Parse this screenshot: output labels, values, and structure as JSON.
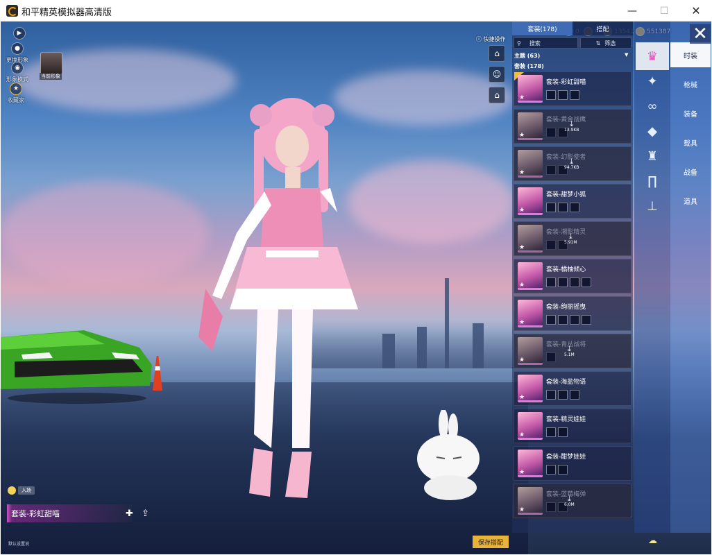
{
  "window": {
    "title": "和平精英模拟器高清版",
    "minimize": "—",
    "maximize": "☐",
    "close": "✕"
  },
  "hud_left": [
    {
      "label": "更换形象",
      "icon": "person-icon"
    },
    {
      "label": "形象模式",
      "icon": "eye-icon"
    },
    {
      "label": "收藏家",
      "icon": "badge-icon"
    }
  ],
  "avatar_caption": "当前形象",
  "quick": {
    "label": "快捷操作"
  },
  "currency": [
    "0",
    "0",
    "13541",
    "551387"
  ],
  "list": {
    "tabs": [
      "套装(178)",
      "搭配"
    ],
    "search_label": "搜索",
    "filter_label": "筛选",
    "group_theme": "主题 (63)",
    "group_suit": "套装 (178)",
    "items": [
      {
        "name": "套装-彩虹甜喵",
        "dim": false,
        "minis": 3,
        "size": ""
      },
      {
        "name": "套装-黄金战鹰",
        "dim": true,
        "minis": 2,
        "size": "13.9KB"
      },
      {
        "name": "套装-幻影使者",
        "dim": true,
        "minis": 2,
        "size": "94.7KB"
      },
      {
        "name": "套装-甜梦小狐",
        "dim": false,
        "minis": 3,
        "size": ""
      },
      {
        "name": "套装-潮影精灵",
        "dim": true,
        "minis": 2,
        "size": "5.91M"
      },
      {
        "name": "套装-橘柚倾心",
        "dim": false,
        "minis": 4,
        "size": ""
      },
      {
        "name": "套装-绚丽摇曳",
        "dim": false,
        "minis": 4,
        "size": ""
      },
      {
        "name": "套装-青丛战将",
        "dim": true,
        "minis": 1,
        "size": "5.1M"
      },
      {
        "name": "套装-海盐物语",
        "dim": false,
        "minis": 3,
        "size": ""
      },
      {
        "name": "套装-精灵娃娃",
        "dim": false,
        "minis": 2,
        "size": ""
      },
      {
        "name": "套装-酣梦娃娃",
        "dim": false,
        "minis": 2,
        "size": ""
      },
      {
        "name": "套装-蓝莓梅弹",
        "dim": true,
        "minis": 2,
        "size": "6.0M"
      }
    ]
  },
  "categories": [
    "时装",
    "枪械",
    "装备",
    "载具",
    "战备",
    "道具"
  ],
  "category_icons": [
    "outfit-icon",
    "gun-icon",
    "goggles-icon",
    "mask-icon",
    "suit-icon",
    "pants-icon",
    "shoes-icon"
  ],
  "bottom": {
    "chip": "入场",
    "current_outfit": "套装-彩虹甜喵",
    "default_note": "默认设置说",
    "save": "保存搭配"
  },
  "colors": {
    "accent": "#3f6cb4",
    "save": "#e9b339",
    "highlight": "#d050c4"
  }
}
